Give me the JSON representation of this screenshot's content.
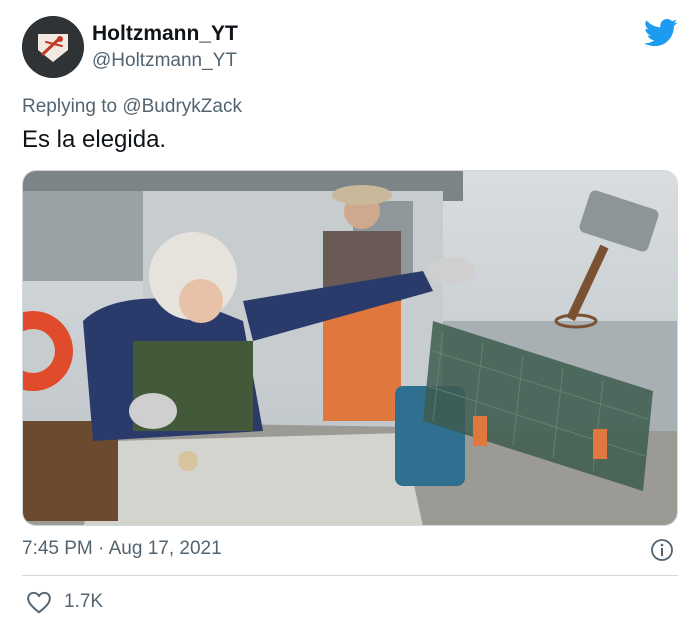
{
  "author": {
    "display_name": "Holtzmann_YT",
    "handle": "@Holtzmann_YT"
  },
  "reply": {
    "prefix": "Replying to",
    "mention": "@BudrykZack"
  },
  "tweet": {
    "text": "Es la elegida."
  },
  "meta": {
    "time": "7:45 PM",
    "separator": "·",
    "date": "Aug 17, 2021"
  },
  "engagement": {
    "likes": "1.7K"
  },
  "icons": {
    "brand": "twitter-bird-icon",
    "info": "info-icon",
    "like": "heart-icon"
  },
  "colors": {
    "brand": "#1d9bf0",
    "text": "#0f1419",
    "secondary": "#536471",
    "divider": "#cfd9de"
  }
}
